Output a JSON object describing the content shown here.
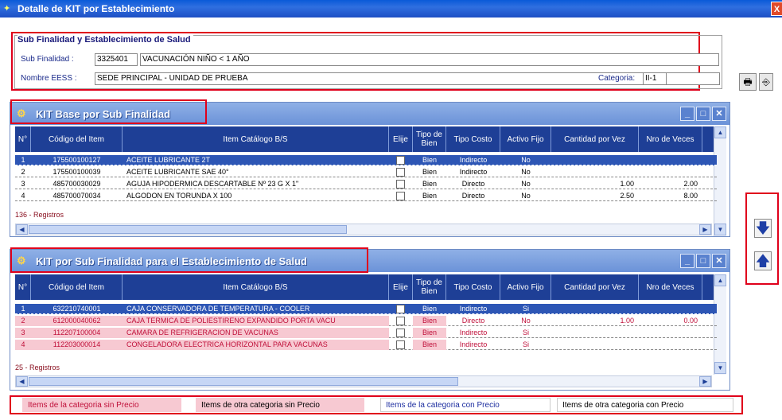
{
  "window": {
    "title": "Detalle de KIT por Establecimiento",
    "close_label": "X"
  },
  "subfinalidad": {
    "legend": "Sub Finalidad y Establecimiento de Salud",
    "sub_finalidad_label": "Sub Finalidad :",
    "sub_finalidad_code": "3325401",
    "sub_finalidad_name": "VACUNACIÓN NIÑO < 1 AÑO",
    "eess_label": "Nombre EESS :",
    "eess_value": "SEDE PRINCIPAL -  UNIDAD DE PRUEBA",
    "categoria_label": "Categoria:",
    "categoria_value": "II-1"
  },
  "columns": {
    "n": "N°",
    "codigo": "Código del Item",
    "item": "Item Catálogo B/S",
    "elije": "Elije",
    "tipo_bien": "Tipo de Bien",
    "tipo_costo": "Tipo Costo",
    "activo_fijo": "Activo Fijo",
    "cantidad": "Cantidad por Vez",
    "nro_veces": "Nro de Veces"
  },
  "kit_base": {
    "title": "KIT Base por Sub Finalidad",
    "registros": "136 - Registros",
    "rows": [
      {
        "n": "1",
        "codigo": "175500100127",
        "item": "ACEITE LUBRICANTE 2T",
        "tipo_bien": "Bien",
        "tipo_costo": "Indirecto",
        "activo_fijo": "No",
        "cantidad": "",
        "nro_veces": ""
      },
      {
        "n": "2",
        "codigo": "175500100039",
        "item": "ACEITE LUBRICANTE SAE 40°",
        "tipo_bien": "Bien",
        "tipo_costo": "Indirecto",
        "activo_fijo": "No",
        "cantidad": "",
        "nro_veces": ""
      },
      {
        "n": "3",
        "codigo": "485700030029",
        "item": "AGUJA HIPODERMICA DESCARTABLE Nº 23 G X 1\"",
        "tipo_bien": "Bien",
        "tipo_costo": "Directo",
        "activo_fijo": "No",
        "cantidad": "1.00",
        "nro_veces": "2.00"
      },
      {
        "n": "4",
        "codigo": "485700070034",
        "item": "ALGODON EN TORUNDA X 100",
        "tipo_bien": "Bien",
        "tipo_costo": "Directo",
        "activo_fijo": "No",
        "cantidad": "2.50",
        "nro_veces": "8.00"
      }
    ]
  },
  "kit_eess": {
    "title": "KIT por Sub Finalidad para el Establecimiento de Salud",
    "registros": "25 - Registros",
    "rows": [
      {
        "n": "1",
        "codigo": "632210740001",
        "item": "CAJA CONSERVADORA DE TEMPERATURA - COOLER",
        "tipo_bien": "Bien",
        "tipo_costo": "Indirecto",
        "activo_fijo": "Si",
        "cantidad": "",
        "nro_veces": ""
      },
      {
        "n": "2",
        "codigo": "612000040062",
        "item": "CAJA TERMICA DE POLIESTIRENO EXPANDIDO PORTA VACU",
        "tipo_bien": "Bien",
        "tipo_costo": "Directo",
        "activo_fijo": "No",
        "cantidad": "1.00",
        "nro_veces": "0.00"
      },
      {
        "n": "3",
        "codigo": "112207100004",
        "item": "CAMARA DE REFRIGERACION DE VACUNAS",
        "tipo_bien": "Bien",
        "tipo_costo": "Indirecto",
        "activo_fijo": "Si",
        "cantidad": "",
        "nro_veces": ""
      },
      {
        "n": "4",
        "codigo": "112203000014",
        "item": "CONGELADORA ELECTRICA HORIZONTAL PARA VACUNAS",
        "tipo_bien": "Bien",
        "tipo_costo": "Indirecto",
        "activo_fijo": "Si",
        "cantidad": "",
        "nro_veces": ""
      }
    ]
  },
  "legend": {
    "cat_sin_precio": "Items de la categoria sin Precio",
    "otra_sin_precio": "Items de otra categoria sin Precio",
    "cat_con_precio": "Items de la categoria con Precio",
    "otra_con_precio": "Items de otra categoria con Precio"
  },
  "colors": {
    "accent": "#1e3f96",
    "highlight": "#e0001b",
    "pink": "#f7c9d2"
  },
  "icons": [
    "settings-icon",
    "printer-icon",
    "exit-icon",
    "move-down-icon",
    "move-up-icon"
  ]
}
